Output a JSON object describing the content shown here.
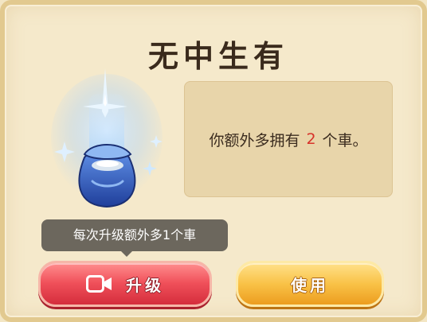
{
  "dialog": {
    "title": "无中生有",
    "info_prefix": "你额外多拥有",
    "info_count": "2",
    "info_suffix": "个車。",
    "tooltip": "每次升级额外多1个車",
    "upgrade_label": "升级",
    "use_label": "使用"
  },
  "icons": {
    "item": "magic-bag-icon",
    "upgrade": "video-icon"
  },
  "colors": {
    "count_highlight": "#d7322a",
    "upgrade_button": "#e8424e",
    "use_button": "#f6b63a",
    "panel_bg": "#f5e9cb"
  }
}
